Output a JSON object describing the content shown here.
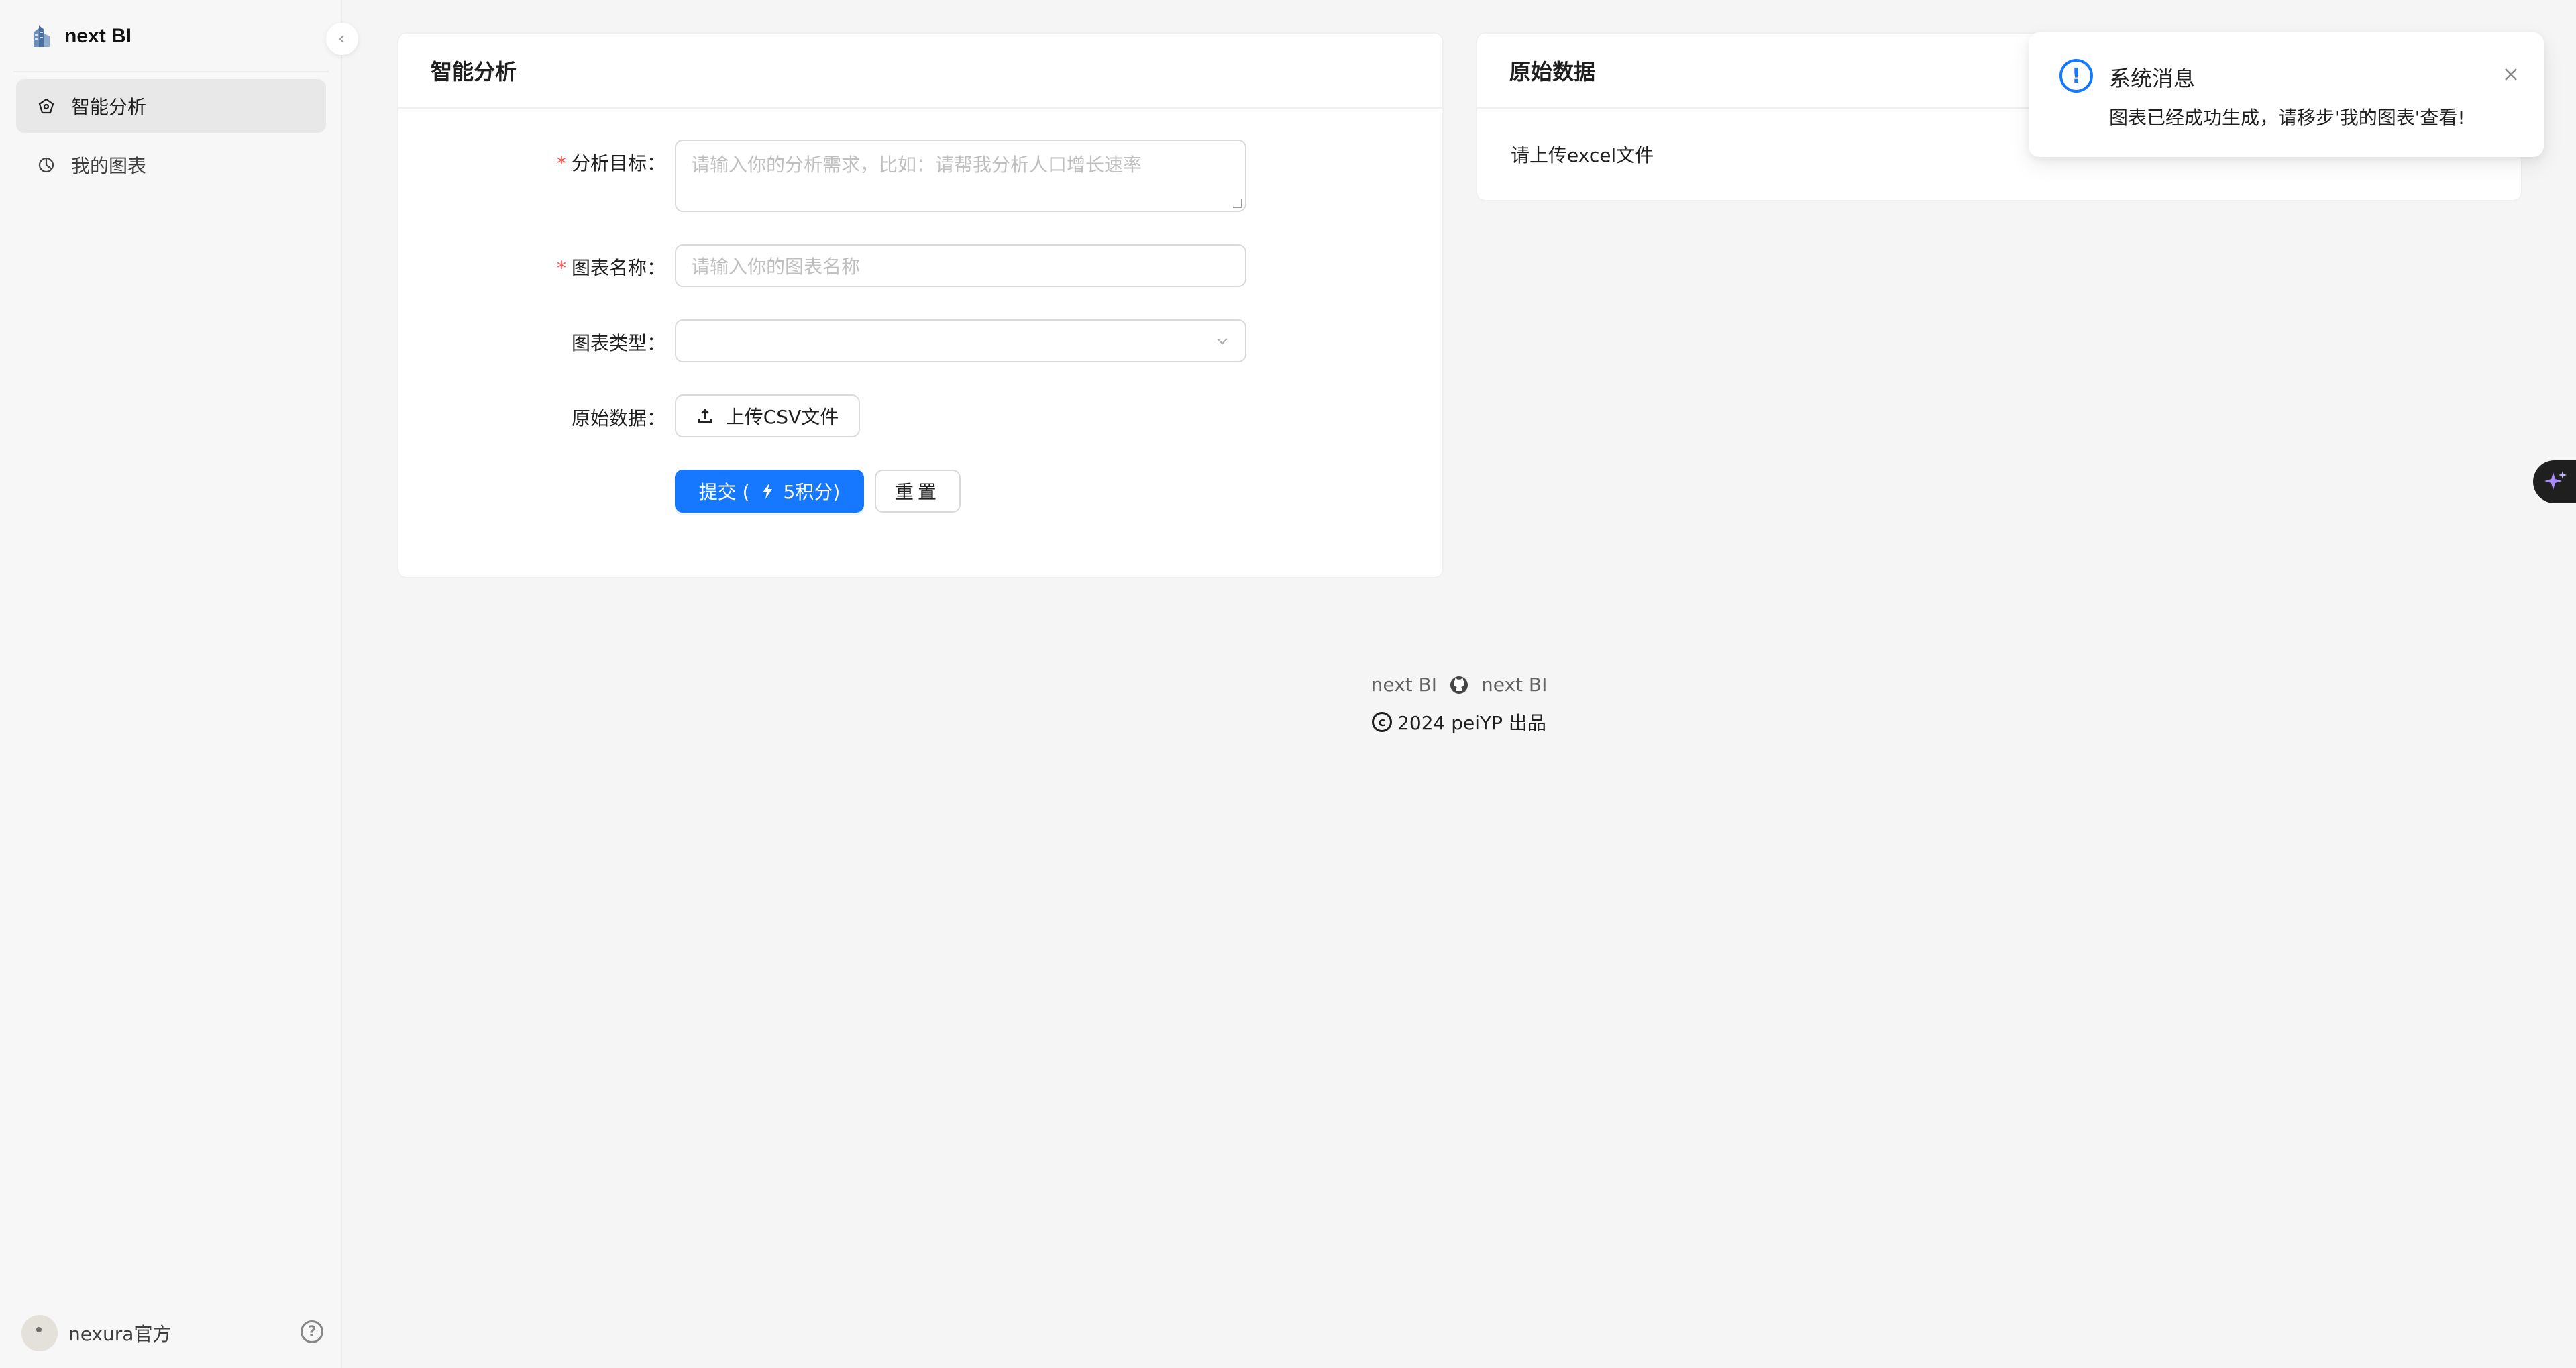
{
  "app": {
    "title": "next BI"
  },
  "sidebar": {
    "items": [
      {
        "label": "智能分析",
        "icon": "dashboard-icon",
        "active": true
      },
      {
        "label": "我的图表",
        "icon": "pie-chart-icon",
        "active": false
      }
    ],
    "user": {
      "name": "nexura官方"
    }
  },
  "form_card": {
    "title": "智能分析",
    "fields": {
      "goal": {
        "label": "分析目标：",
        "required": true,
        "placeholder": "请输入你的分析需求，比如：请帮我分析人口增长速率"
      },
      "chart_name": {
        "label": "图表名称：",
        "required": true,
        "placeholder": "请输入你的图表名称"
      },
      "chart_type": {
        "label": "图表类型：",
        "required": false,
        "value": ""
      },
      "raw_data": {
        "label": "原始数据：",
        "required": false,
        "upload_label": "上传CSV文件"
      }
    },
    "submit": {
      "prefix": "提交 (",
      "points": "5积分)"
    },
    "reset": {
      "label": "重置"
    }
  },
  "data_card": {
    "title": "原始数据",
    "body": "请上传excel文件"
  },
  "footer": {
    "left": "next BI",
    "right": "next BI",
    "copyright": "2024 peiYP 出品"
  },
  "notification": {
    "title": "系统消息",
    "description": "图表已经成功生成，请移步'我的图表'查看!"
  },
  "colors": {
    "primary": "#1677ff",
    "required": "#ff4d4f",
    "ai_accent": "#8b5cf6"
  }
}
